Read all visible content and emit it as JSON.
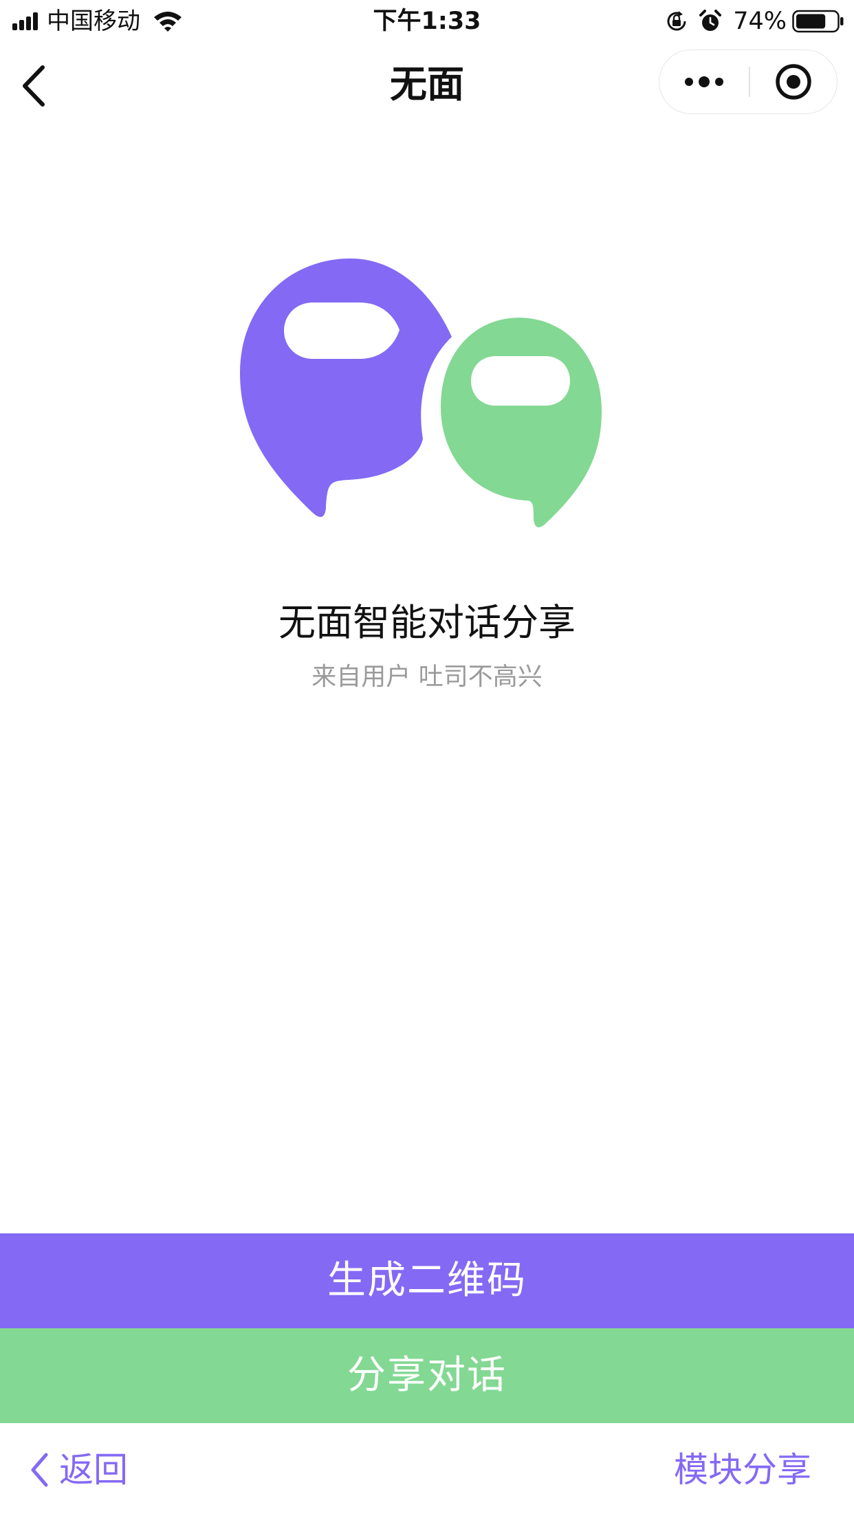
{
  "status_bar": {
    "carrier": "中国移动",
    "time": "下午1:33",
    "battery_percent": "74%",
    "signal_icon": "cellular-signal-icon",
    "wifi_icon": "wifi-icon",
    "rotation_lock_icon": "rotation-lock-icon",
    "alarm_icon": "alarm-icon",
    "battery_icon": "battery-icon",
    "battery_level": 0.74
  },
  "nav": {
    "title": "无面",
    "back_icon": "chevron-left-icon",
    "more_icon": "more-dots-icon",
    "close_icon": "mini-program-close-icon"
  },
  "main": {
    "logo_icon": "speech-bubbles-logo",
    "title": "无面智能对话分享",
    "subtitle": "来自用户 吐司不高兴"
  },
  "buttons": {
    "generate_qr": "生成二维码",
    "share_dialog": "分享对话"
  },
  "bottom": {
    "back_label": "返回",
    "back_icon": "chevron-left-icon",
    "module_share": "模块分享"
  },
  "colors": {
    "purple": "#8469F4",
    "green": "#83D893",
    "subtitle_gray": "#9A9A9A",
    "text_dark": "#111111"
  }
}
